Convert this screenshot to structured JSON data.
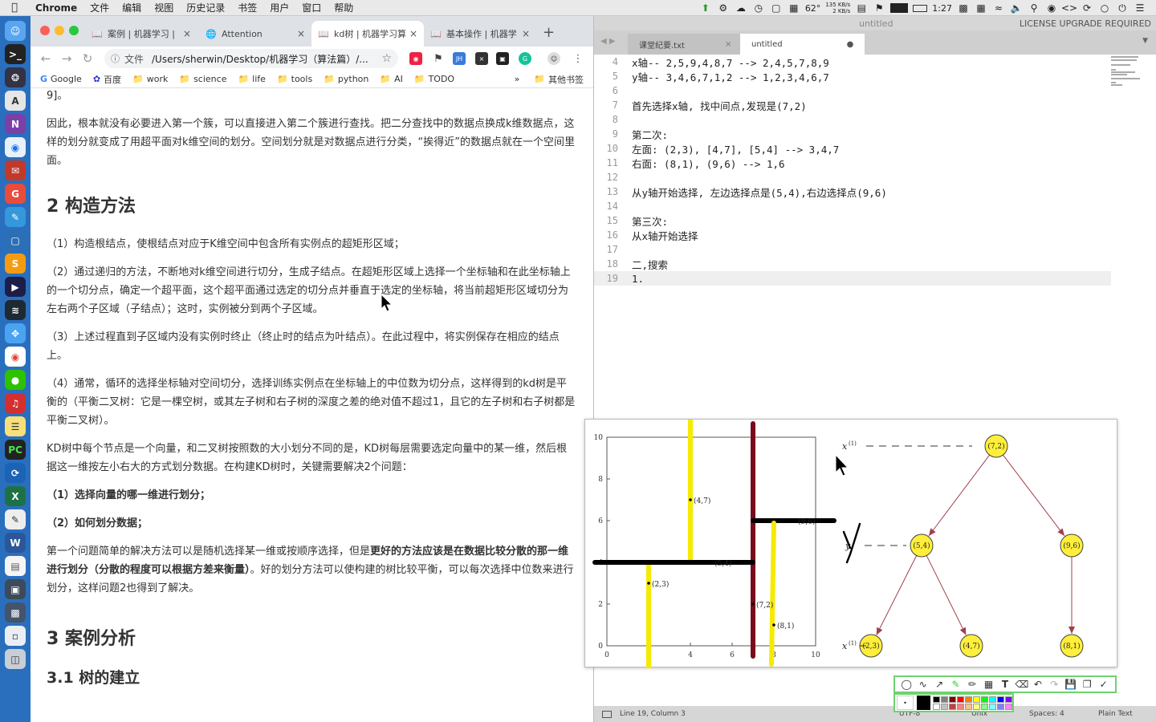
{
  "menubar": {
    "app_name": "Chrome",
    "items": [
      "文件",
      "编辑",
      "视图",
      "历史记录",
      "书签",
      "用户",
      "窗口",
      "帮助"
    ],
    "temperature": "62°",
    "net_up": "135 KB/s",
    "net_down": "2 KB/s",
    "time": "1:27"
  },
  "chrome": {
    "tabs": [
      {
        "title": "案例 | 机器学习 |",
        "icon": "book-icon"
      },
      {
        "title": "Attention",
        "icon": "globe-icon"
      },
      {
        "title": "kd树 | 机器学习算",
        "icon": "book-icon"
      },
      {
        "title": "基本操作 | 机器学",
        "icon": "book-icon"
      }
    ],
    "url_label": "文件",
    "url": "/Users/sherwin/Desktop/机器学习（算法篇）/...",
    "bookmarks": [
      "Google",
      "百度",
      "work",
      "science",
      "life",
      "tools",
      "python",
      "AI",
      "TODO"
    ],
    "other_bookmarks": "其他书签",
    "overflow": "»"
  },
  "article": {
    "p0": "9]。",
    "p1": "因此，根本就没有必要进入第一个簇，可以直接进入第二个簇进行查找。把二分查找中的数据点换成k维数据点，这样的划分就变成了用超平面对k维空间的划分。空间划分就是对数据点进行分类，“挨得近”的数据点就在一个空间里面。",
    "h2_construct": "2 构造方法",
    "step1": "（1）构造根结点，使根结点对应于K维空间中包含所有实例点的超矩形区域；",
    "step2": "（2）通过递归的方法，不断地对k维空间进行切分，生成子结点。在超矩形区域上选择一个坐标轴和在此坐标轴上的一个切分点，确定一个超平面，这个超平面通过选定的切分点并垂直于选定的坐标轴，将当前超矩形区域切分为左右两个子区域（子结点）；这时，实例被分到两个子区域。",
    "step3": "（3）上述过程直到子区域内没有实例时终止（终止时的结点为叶结点）。在此过程中，将实例保存在相应的结点上。",
    "step4": "（4）通常，循环的选择坐标轴对空间切分，选择训练实例点在坐标轴上的中位数为切分点，这样得到的kd树是平衡的（平衡二叉树：它是一棵空树，或其左子树和右子树的深度之差的绝对值不超过1，且它的左子树和右子树都是平衡二叉树）。",
    "kd_intro": "KD树中每个节点是一个向量，和二叉树按照数的大小划分不同的是，KD树每层需要选定向量中的某一维，然后根据这一维按左小右大的方式划分数据。在构建KD树时，关键需要解决2个问题：",
    "q1": "（1）选择向量的哪一维进行划分；",
    "q2": "（2）如何划分数据；",
    "answer_a": "第一个问题简单的解决方法可以是随机选择某一维或按顺序选择，但是",
    "answer_bold": "更好的方法应该是在数据比较分散的那一维进行划分（分散的程度可以根据方差来衡量）",
    "answer_b": "。好的划分方法可以使构建的树比较平衡，可以每次选择中位数来进行划分，这样问题2也得到了解决。",
    "h2_case": "3 案例分析",
    "h3_tree": "3.1 树的建立"
  },
  "sublime": {
    "window_title": "untitled",
    "license": "LICENSE UPGRADE REQUIRED",
    "tabs": [
      "课堂纪要.txt",
      "untitled"
    ],
    "lines": [
      {
        "no": "4",
        "text": "x轴-- 2,5,9,4,8,7 --> 2,4,5,7,8,9"
      },
      {
        "no": "5",
        "text": "y轴-- 3,4,6,7,1,2 --> 1,2,3,4,6,7"
      },
      {
        "no": "6",
        "text": ""
      },
      {
        "no": "7",
        "text": "首先选择x轴, 找中间点,发现是(7,2)"
      },
      {
        "no": "8",
        "text": ""
      },
      {
        "no": "9",
        "text": "第二次:"
      },
      {
        "no": "10",
        "text": "左面: (2,3), [4,7], [5,4] --> 3,4,7"
      },
      {
        "no": "11",
        "text": "右面: (8,1), (9,6) --> 1,6"
      },
      {
        "no": "12",
        "text": ""
      },
      {
        "no": "13",
        "text": "从y轴开始选择, 左边选择点是(5,4),右边选择点(9,6)"
      },
      {
        "no": "14",
        "text": ""
      },
      {
        "no": "15",
        "text": "第三次:"
      },
      {
        "no": "16",
        "text": "从x轴开始选择"
      },
      {
        "no": "17",
        "text": ""
      },
      {
        "no": "18",
        "text": "二,搜索"
      },
      {
        "no": "19",
        "text": "1."
      }
    ],
    "status": {
      "position": "Line 19, Column 3",
      "encoding": "UTF-8",
      "line_endings": "Unix",
      "spaces": "Spaces: 4",
      "syntax": "Plain Text"
    }
  },
  "figure": {
    "x_ticks": [
      "0",
      "2",
      "4",
      "6",
      "8",
      "10"
    ],
    "y_ticks": [
      "0",
      "2",
      "4",
      "6",
      "8",
      "10"
    ],
    "points": [
      {
        "label": "(2,3)",
        "x": 2,
        "y": 3
      },
      {
        "label": "(5,4)",
        "x": 5,
        "y": 4
      },
      {
        "label": "(9,6)",
        "x": 9,
        "y": 6
      },
      {
        "label": "(4,7)",
        "x": 4,
        "y": 7
      },
      {
        "label": "(8,1)",
        "x": 8,
        "y": 1
      },
      {
        "label": "(7,2)",
        "x": 7,
        "y": 2
      }
    ],
    "tree_nodes": [
      {
        "label": "(7,2)",
        "level": 0
      },
      {
        "label": "(5,4)",
        "level": 1
      },
      {
        "label": "(9,6)",
        "level": 1
      },
      {
        "label": "(2,3)",
        "level": 2
      },
      {
        "label": "(4,7)",
        "level": 2
      },
      {
        "label": "(8,1)",
        "level": 2
      }
    ],
    "level_labels": [
      "x",
      "y",
      "x"
    ],
    "level_superscripts": [
      "(1)",
      "",
      "(1)"
    ],
    "colors": {
      "node_fill": "#ffef3a",
      "yellow_line": "#f5ea00",
      "dark_red_line": "#7a0b1c",
      "arrow": "#a0404a"
    }
  },
  "annotation_palette": [
    "#000000",
    "#808080",
    "#800000",
    "#ff0000",
    "#ff8000",
    "#ffff00",
    "#00ff00",
    "#00ffff",
    "#0000ff",
    "#8000ff",
    "#ffffff",
    "#c0c0c0",
    "#c04040",
    "#ff8080",
    "#ffc080",
    "#ffff80",
    "#80ff80",
    "#80ffff",
    "#8080ff",
    "#ff80ff"
  ]
}
